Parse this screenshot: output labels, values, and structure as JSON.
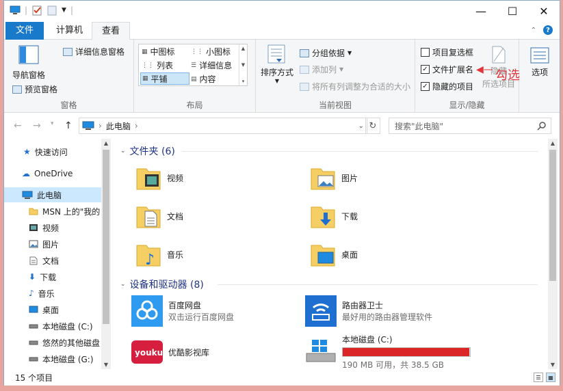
{
  "tabs": {
    "file": "文件",
    "computer": "计算机",
    "view": "查看"
  },
  "ribbon": {
    "panes": {
      "nav_pane": "导航窗格",
      "preview_pane": "预览窗格",
      "details_pane": "详细信息窗格",
      "label": "窗格"
    },
    "layout": {
      "options": [
        "中图标",
        "小图标",
        "列表",
        "详细信息",
        "平铺",
        "内容"
      ],
      "selected": "平铺",
      "label": "布局"
    },
    "current_view": {
      "sort_by": "排序方式",
      "group_by": "分组依据",
      "add_columns": "添加列",
      "fit_columns": "将所有列调整为合适的大小",
      "label": "当前视图"
    },
    "show_hide": {
      "item_checkboxes": "项目复选框",
      "item_checkboxes_checked": false,
      "file_extensions": "文件扩展名",
      "file_extensions_checked": true,
      "hidden_items": "隐藏的项目",
      "hidden_items_checked": true,
      "hide": "隐藏",
      "hide_selected": "所选项目",
      "label": "显示/隐藏"
    },
    "options": "选项"
  },
  "annotation": "勾选",
  "address": {
    "location": "此电脑",
    "search_placeholder": "搜索\"此电脑\""
  },
  "nav": [
    {
      "label": "快速访问",
      "icon": "star-icon"
    },
    {
      "label": "OneDrive",
      "icon": "cloud-icon"
    },
    {
      "label": "此电脑",
      "icon": "computer-icon"
    },
    {
      "label": "MSN 上的\"我的",
      "icon": "folder-icon"
    },
    {
      "label": "视频",
      "icon": "video-icon"
    },
    {
      "label": "图片",
      "icon": "picture-icon"
    },
    {
      "label": "文档",
      "icon": "document-icon"
    },
    {
      "label": "下载",
      "icon": "download-icon"
    },
    {
      "label": "音乐",
      "icon": "music-icon"
    },
    {
      "label": "桌面",
      "icon": "desktop-icon"
    },
    {
      "label": "本地磁盘 (C:)",
      "icon": "drive-icon"
    },
    {
      "label": "悠然的其他磁盘",
      "icon": "drive-icon"
    },
    {
      "label": "本地磁盘 (G:)",
      "icon": "drive-icon"
    }
  ],
  "folders_header": "文件夹 (6)",
  "folders": [
    "视频",
    "图片",
    "文档",
    "下载",
    "音乐",
    "桌面"
  ],
  "devices_header": "设备和驱动器 (8)",
  "devices": [
    {
      "name": "百度网盘",
      "sub": "双击运行百度网盘"
    },
    {
      "name": "路由器卫士",
      "sub": "最好用的路由器管理软件"
    },
    {
      "name": "优酷影视库",
      "sub": ""
    },
    {
      "name": "本地磁盘 (C:)",
      "sub": "190 MB 可用，共 38.5 GB",
      "used_fraction": 0.995
    }
  ],
  "status": "15 个项目",
  "colors": {
    "accent": "#1979ca",
    "drive_full": "#da2626",
    "annotation": "#e3343b"
  }
}
